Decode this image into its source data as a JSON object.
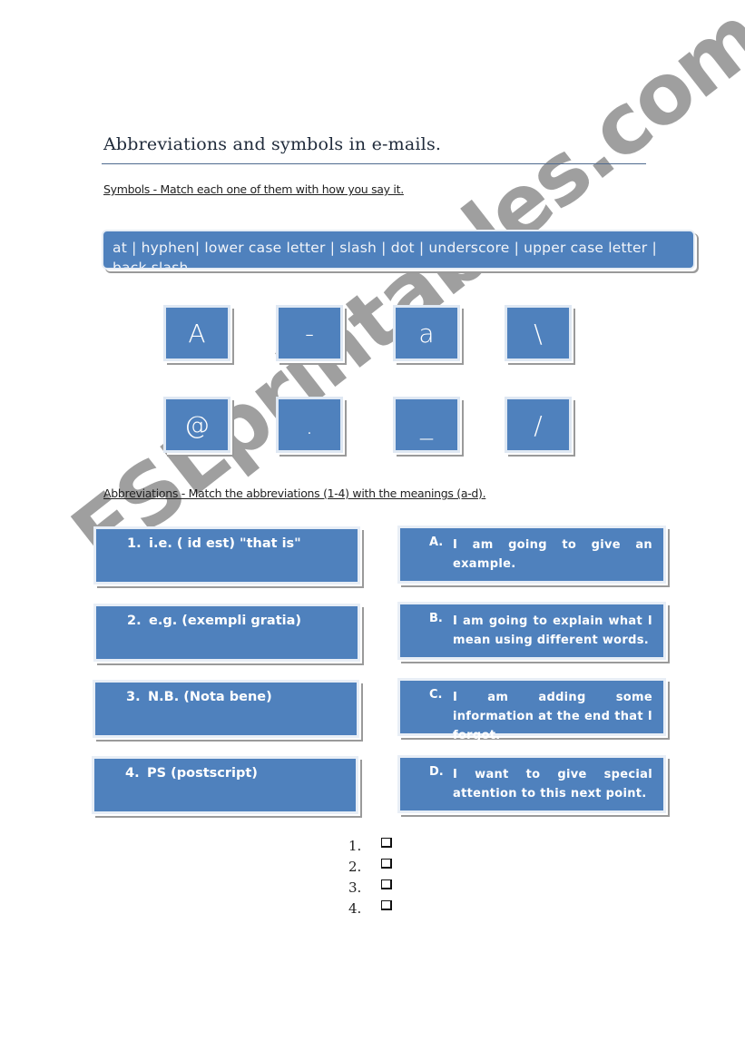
{
  "document": {
    "title": "Abbreviations and symbols in e-mails.",
    "symbols_section": {
      "instruction": "Symbols - Match each one of them with how you say it.",
      "word_bank": "at | hyphen| lower case letter | slash | dot | underscore | upper case letter | back slash",
      "symbols": [
        "A",
        "-",
        "a",
        "\\",
        "@",
        ".",
        "_",
        "/"
      ]
    },
    "abbreviations_section": {
      "instruction": "Abbreviations - Match the abbreviations (1-4) with the meanings (a-d).",
      "abbreviations": [
        {
          "num": "1.",
          "text": "i.e. ( id est) \"that is\""
        },
        {
          "num": "2.",
          "text": "e.g. (exempli gratia)"
        },
        {
          "num": "3.",
          "text": "N.B. (Nota bene)"
        },
        {
          "num": "4.",
          "text": "PS (postscript)"
        }
      ],
      "meanings": [
        {
          "letter": "A.",
          "text": "I am going to give an example."
        },
        {
          "letter": "B.",
          "text": "I am going to explain what I mean using different words."
        },
        {
          "letter": "C.",
          "text": "I am adding some information at the end that I forgot."
        },
        {
          "letter": "D.",
          "text": "I want to give special attention to this next point."
        }
      ],
      "answer_lines": [
        "1.",
        "2.",
        "3.",
        "4."
      ]
    },
    "watermark": "ESLprintables.com"
  }
}
